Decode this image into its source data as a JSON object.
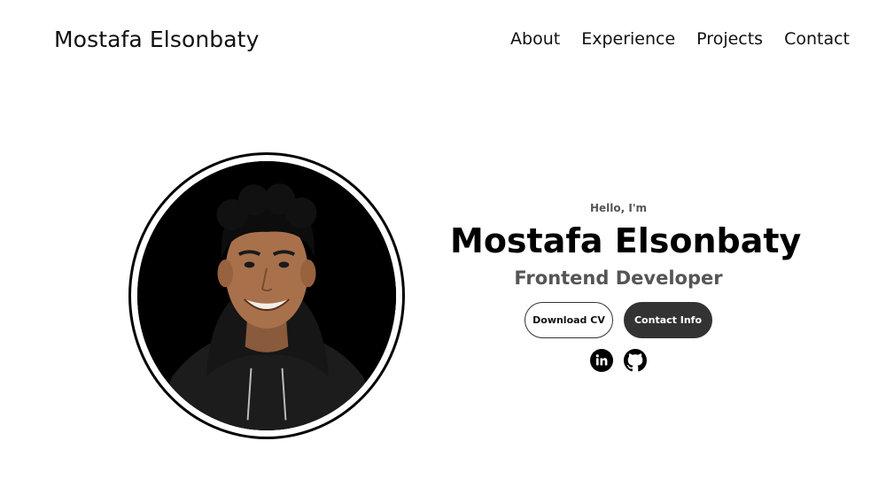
{
  "nav": {
    "logo": "Mostafa Elsonbaty",
    "links": [
      {
        "label": "About"
      },
      {
        "label": "Experience"
      },
      {
        "label": "Projects"
      },
      {
        "label": "Contact"
      }
    ]
  },
  "profile": {
    "greeting": "Hello, I'm",
    "name": "Mostafa Elsonbaty",
    "role": "Frontend Developer",
    "buttons": {
      "download_cv": "Download CV",
      "contact_info": "Contact Info"
    },
    "socials": [
      {
        "icon": "linkedin-icon"
      },
      {
        "icon": "github-icon"
      }
    ]
  },
  "colors": {
    "background": "#ffffff",
    "text": "#000000",
    "muted": "#555555",
    "button_dark": "#333333"
  }
}
